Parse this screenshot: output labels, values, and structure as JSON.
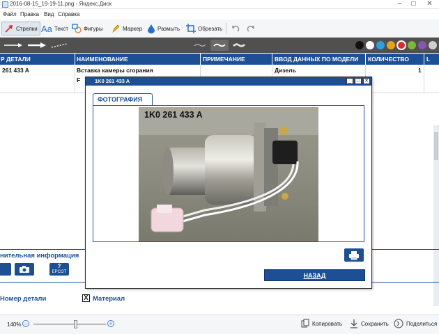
{
  "window": {
    "title": "2016-08-15_19-19-11.png - Яндекс.Диск",
    "minimize": "–",
    "maximize": "□",
    "close": "✕"
  },
  "menu": [
    "Файл",
    "Правка",
    "Вид",
    "Справка"
  ],
  "toolbar": {
    "tools": [
      {
        "label": "Стрелки",
        "icon": "arrow-icon",
        "active": true
      },
      {
        "label": "Текст",
        "icon": "text-icon"
      },
      {
        "label": "Фигуры",
        "icon": "shapes-icon"
      },
      {
        "label": "Маркер",
        "icon": "marker-icon"
      },
      {
        "label": "Размыть",
        "icon": "blur-drop-icon"
      },
      {
        "label": "Обрезать",
        "icon": "crop-icon"
      }
    ],
    "undo_icon": "undo-icon",
    "redo_icon": "redo-icon"
  },
  "colors": {
    "palette": [
      "#111111",
      "#ffffff",
      "#2ea0dc",
      "#e6a21c",
      "#d62e2e",
      "#7ab83a",
      "#8a55b0",
      "#cfcfcf"
    ],
    "selected": "#d62e2e",
    "header_blue": "#1d4f95"
  },
  "table": {
    "headers": [
      "Р ДЕТАЛИ",
      "НАИМЕНОВАНИЕ",
      "ПРИМЕЧАНИЕ",
      "ВВОД ДАННЫХ ПО МОДЕЛИ",
      "КОЛИЧЕСТВО",
      "L"
    ],
    "row": {
      "part": "261 433 A",
      "name": "Вставка камеры сгорания",
      "name2": "F",
      "note": "",
      "model": "Дизель",
      "qty": "1"
    }
  },
  "background": {
    "add_info": "нительная информация",
    "btn_camera_icon": "camera-icon",
    "btn_epc_label": "EPCOT",
    "part_number_label": "Номер детали",
    "material_check": "X",
    "material_label": "Материал"
  },
  "dialog": {
    "title": "1K0 261 433 A",
    "tab": "ФОТОГРАФИЯ",
    "photo_label": "1K0 261 433 A",
    "print_icon": "printer-icon",
    "back_button": "НАЗАД",
    "ctrl_min": "_",
    "ctrl_max": "□",
    "ctrl_close": "✕"
  },
  "statusbar": {
    "zoom": "140%",
    "zoom_out": "–",
    "zoom_in": "+",
    "copy": "Копировать",
    "save": "Сохранить",
    "share": "Поделиться"
  }
}
